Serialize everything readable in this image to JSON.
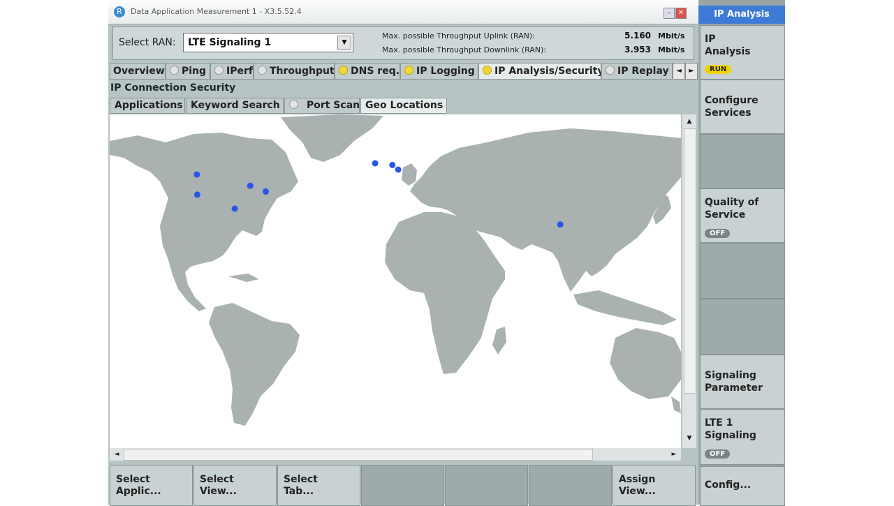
{
  "window": {
    "title": "Data Application Measurement 1 - X3.5.52.4",
    "logo_glyph": "R",
    "min_glyph": "–",
    "close_glyph": "✕"
  },
  "ran": {
    "label": "Select RAN:",
    "selected": "LTE Signaling 1",
    "dropdown_glyph": "▼",
    "uplink_label": "Max. possible Throughput Uplink (RAN):",
    "uplink_value": "5.160",
    "uplink_unit": "Mbit/s",
    "downlink_label": "Max. possible Throughput Downlink (RAN):",
    "downlink_value": "3.953",
    "downlink_unit": "Mbit/s"
  },
  "tabs": [
    {
      "label": "Overview",
      "status": "none"
    },
    {
      "label": "Ping",
      "status": "off"
    },
    {
      "label": "IPerf",
      "status": "off"
    },
    {
      "label": "Throughput",
      "status": "off"
    },
    {
      "label": "DNS req.",
      "status": "on"
    },
    {
      "label": "IP Logging",
      "status": "on"
    },
    {
      "label": "IP Analysis/Security",
      "status": "on"
    },
    {
      "label": "IP Replay",
      "status": "off"
    }
  ],
  "tab_scroll": {
    "left": "◄",
    "right": "►"
  },
  "section_title": "IP Connection Security",
  "subtabs": [
    {
      "label": "Applications",
      "status": "none"
    },
    {
      "label": "Keyword Search",
      "status": "none"
    },
    {
      "label": "Port Scan",
      "status": "off"
    },
    {
      "label": "Geo Locations",
      "status": "none"
    }
  ],
  "map": {
    "land_color": "#a9b1b1",
    "marker_color": "#2a55e8",
    "markers": [
      {
        "lat": 47.6,
        "lon": -122.3
      },
      {
        "lat": 37.4,
        "lon": -122.1
      },
      {
        "lat": 41.9,
        "lon": -87.6
      },
      {
        "lat": 39.0,
        "lon": -77.5
      },
      {
        "lat": 30.3,
        "lon": -97.7
      },
      {
        "lat": 53.3,
        "lon": -6.3
      },
      {
        "lat": 52.4,
        "lon": 4.9
      },
      {
        "lat": 50.1,
        "lon": 8.7
      },
      {
        "lat": 22.3,
        "lon": 114.2
      }
    ]
  },
  "scroll": {
    "up": "▲",
    "down": "▼",
    "left": "◄",
    "right": "►"
  },
  "softkeys": [
    {
      "label": "Select\nApplic..."
    },
    {
      "label": "Select\nView..."
    },
    {
      "label": "Select\nTab..."
    },
    {
      "label": ""
    },
    {
      "label": ""
    },
    {
      "label": ""
    },
    {
      "label": "Assign\nView..."
    }
  ],
  "right_panel": {
    "header": "IP Analysis",
    "keys": [
      {
        "label": "IP\nAnalysis",
        "badge": "RUN",
        "badge_type": "run"
      },
      {
        "label": "Configure\nServices",
        "badge": "",
        "badge_type": ""
      },
      {
        "label": "",
        "badge": "",
        "badge_type": ""
      },
      {
        "label": "Quality of\n Service",
        "badge": "OFF",
        "badge_type": "off"
      },
      {
        "label": "",
        "badge": "",
        "badge_type": ""
      },
      {
        "label": "",
        "badge": "",
        "badge_type": ""
      },
      {
        "label": "Signaling\nParameter",
        "badge": "",
        "badge_type": ""
      },
      {
        "label": "LTE 1\nSignaling",
        "badge": "OFF",
        "badge_type": "off"
      }
    ],
    "config_label": "Config..."
  }
}
